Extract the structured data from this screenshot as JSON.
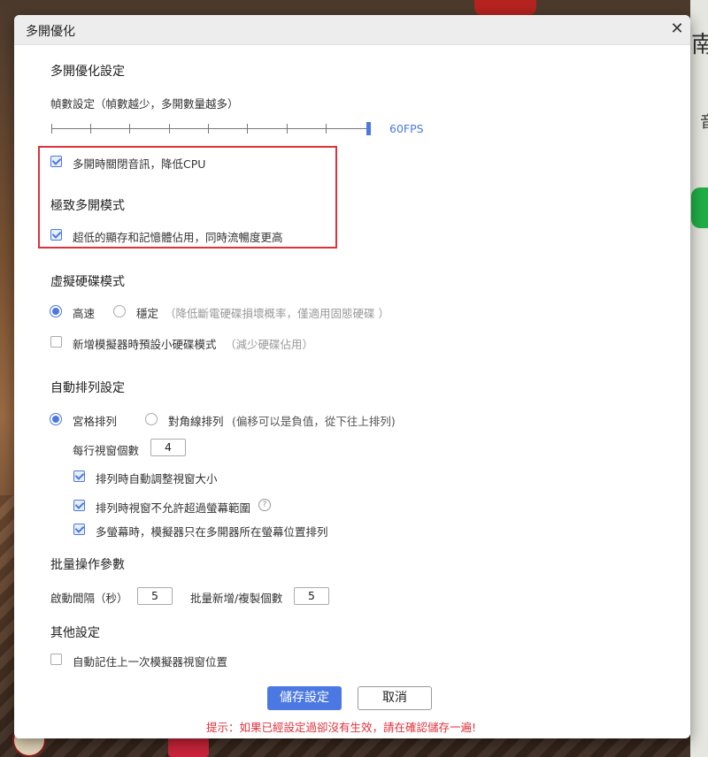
{
  "dialog": {
    "title": "多開優化",
    "close_label": "✕"
  },
  "optimize": {
    "heading": "多開優化設定",
    "fps_label": "幀數設定（幀數越少，多開數量越多）",
    "fps_value": "60FPS",
    "fps_level_fraction": 1.0,
    "mute_label": "多開時關閉音訊，降低CPU",
    "mute_checked": true
  },
  "extreme": {
    "heading": "極致多開模式",
    "option_label": "超低的顯存和記憶體佔用，同時流暢度更高",
    "checked": true
  },
  "disk": {
    "heading": "虛擬硬碟模式",
    "radio_fast": "高速",
    "radio_stable": "穩定",
    "stable_hint": "（降低斷電硬碟損壞概率，僅適用固態硬碟 ）",
    "selected": "高速",
    "small_disk_label": "新增模擬器時預設小硬碟模式",
    "small_disk_hint": "（減少硬碟佔用）",
    "small_disk_checked": false
  },
  "arrange": {
    "heading": "自動排列設定",
    "radio_grid": "宮格排列",
    "radio_diagonal": "對角線排列",
    "diagonal_hint": "(偏移可以是負值，從下往上排列)",
    "selected": "宮格排列",
    "per_row_label": "每行視窗個數",
    "per_row_value": "4",
    "auto_resize_label": "排列時自動調整視窗大小",
    "auto_resize_checked": true,
    "no_overflow_label": "排列時視窗不允許超過螢幕範圍",
    "no_overflow_checked": true,
    "help_glyph": "?",
    "multi_screen_label": "多螢幕時，模擬器只在多開器所在螢幕位置排列",
    "multi_screen_checked": true
  },
  "batch": {
    "heading": "批量操作參數",
    "interval_label": "啟動間隔（秒）",
    "interval_value": "5",
    "count_label": "批量新增/複製個數",
    "count_value": "5"
  },
  "other": {
    "heading": "其他設定",
    "remember_label": "自動記住上一次模擬器視窗位置",
    "remember_checked": false
  },
  "footer": {
    "save_label": "儲存設定",
    "cancel_label": "取消",
    "warning": "提示：如果已經設定過卻沒有生效，請在確認儲存一遍!"
  },
  "colors": {
    "accent": "#4b78e2",
    "highlight_box": "#e0313a",
    "warning_text": "#e0313a"
  },
  "background": {
    "partial_glyph_1": "南",
    "partial_glyph_2": "音"
  }
}
